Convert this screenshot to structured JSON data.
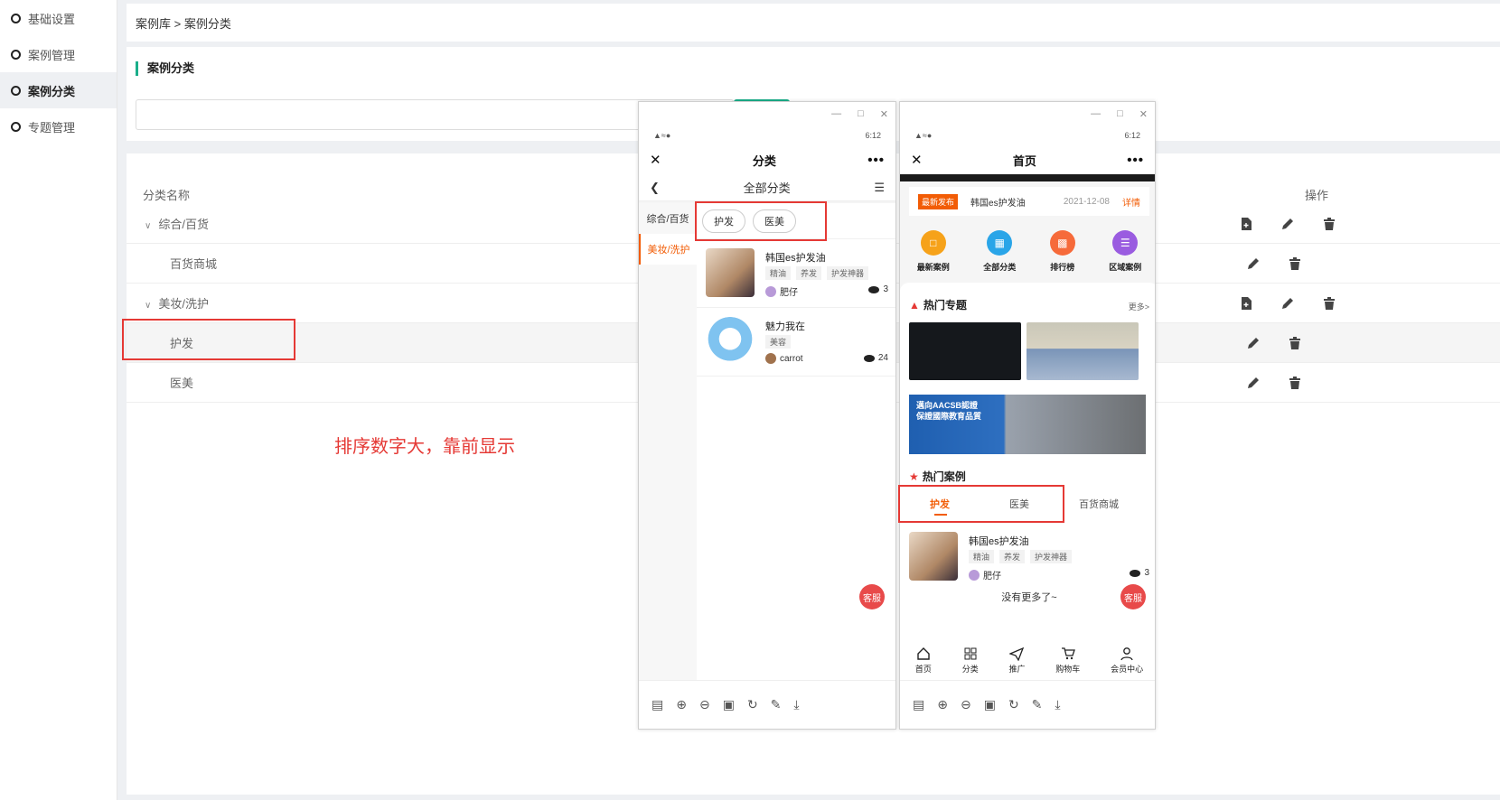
{
  "sidebar": {
    "items": [
      {
        "label": "基础设置"
      },
      {
        "label": "案例管理"
      },
      {
        "label": "案例分类"
      },
      {
        "label": "专题管理"
      }
    ]
  },
  "breadcrumb": "案例库 > 案例分类",
  "page_title": "案例分类",
  "table": {
    "col_name": "分类名称",
    "col_op": "操作",
    "rows": [
      {
        "name": "综合/百货"
      },
      {
        "name": "百货商城"
      },
      {
        "name": "美妆/洗护"
      },
      {
        "name": "护发"
      },
      {
        "name": "医美"
      }
    ]
  },
  "annotation": "排序数字大，靠前显示",
  "phone1": {
    "title": "分类",
    "header": "全部分类",
    "categories": [
      "综合/百货",
      "美妆/洗护"
    ],
    "chips": [
      "护发",
      "医美"
    ],
    "cases": [
      {
        "title": "韩国es护发油",
        "tags": [
          "精油",
          "养发",
          "护发神器"
        ],
        "author": "肥仔",
        "views": "3"
      },
      {
        "title": "魅力我在",
        "tags": [
          "美容"
        ],
        "author": "carrot",
        "views": "24"
      }
    ],
    "service": "客服",
    "time": "6:12"
  },
  "phone2": {
    "title": "首页",
    "notice": {
      "badge": "最新发布",
      "text": "韩国es护发油",
      "date": "2021-12-08",
      "more": "详情"
    },
    "quick": [
      "最新案例",
      "全部分类",
      "排行榜",
      "区域案例"
    ],
    "hot_topics": "热门专题",
    "more": "更多>",
    "aacsb": "邁向AACSB認證\n保證國際教育品質",
    "hot_cases": "热门案例",
    "tabs": [
      "护发",
      "医美",
      "百货商城"
    ],
    "case": {
      "title": "韩国es护发油",
      "tags": [
        "精油",
        "养发",
        "护发神器"
      ],
      "author": "肥仔",
      "views": "3"
    },
    "nomore": "没有更多了~",
    "service": "客服",
    "tabbar": [
      "首页",
      "分类",
      "推广",
      "购物车",
      "会员中心"
    ],
    "time": "6:12"
  }
}
